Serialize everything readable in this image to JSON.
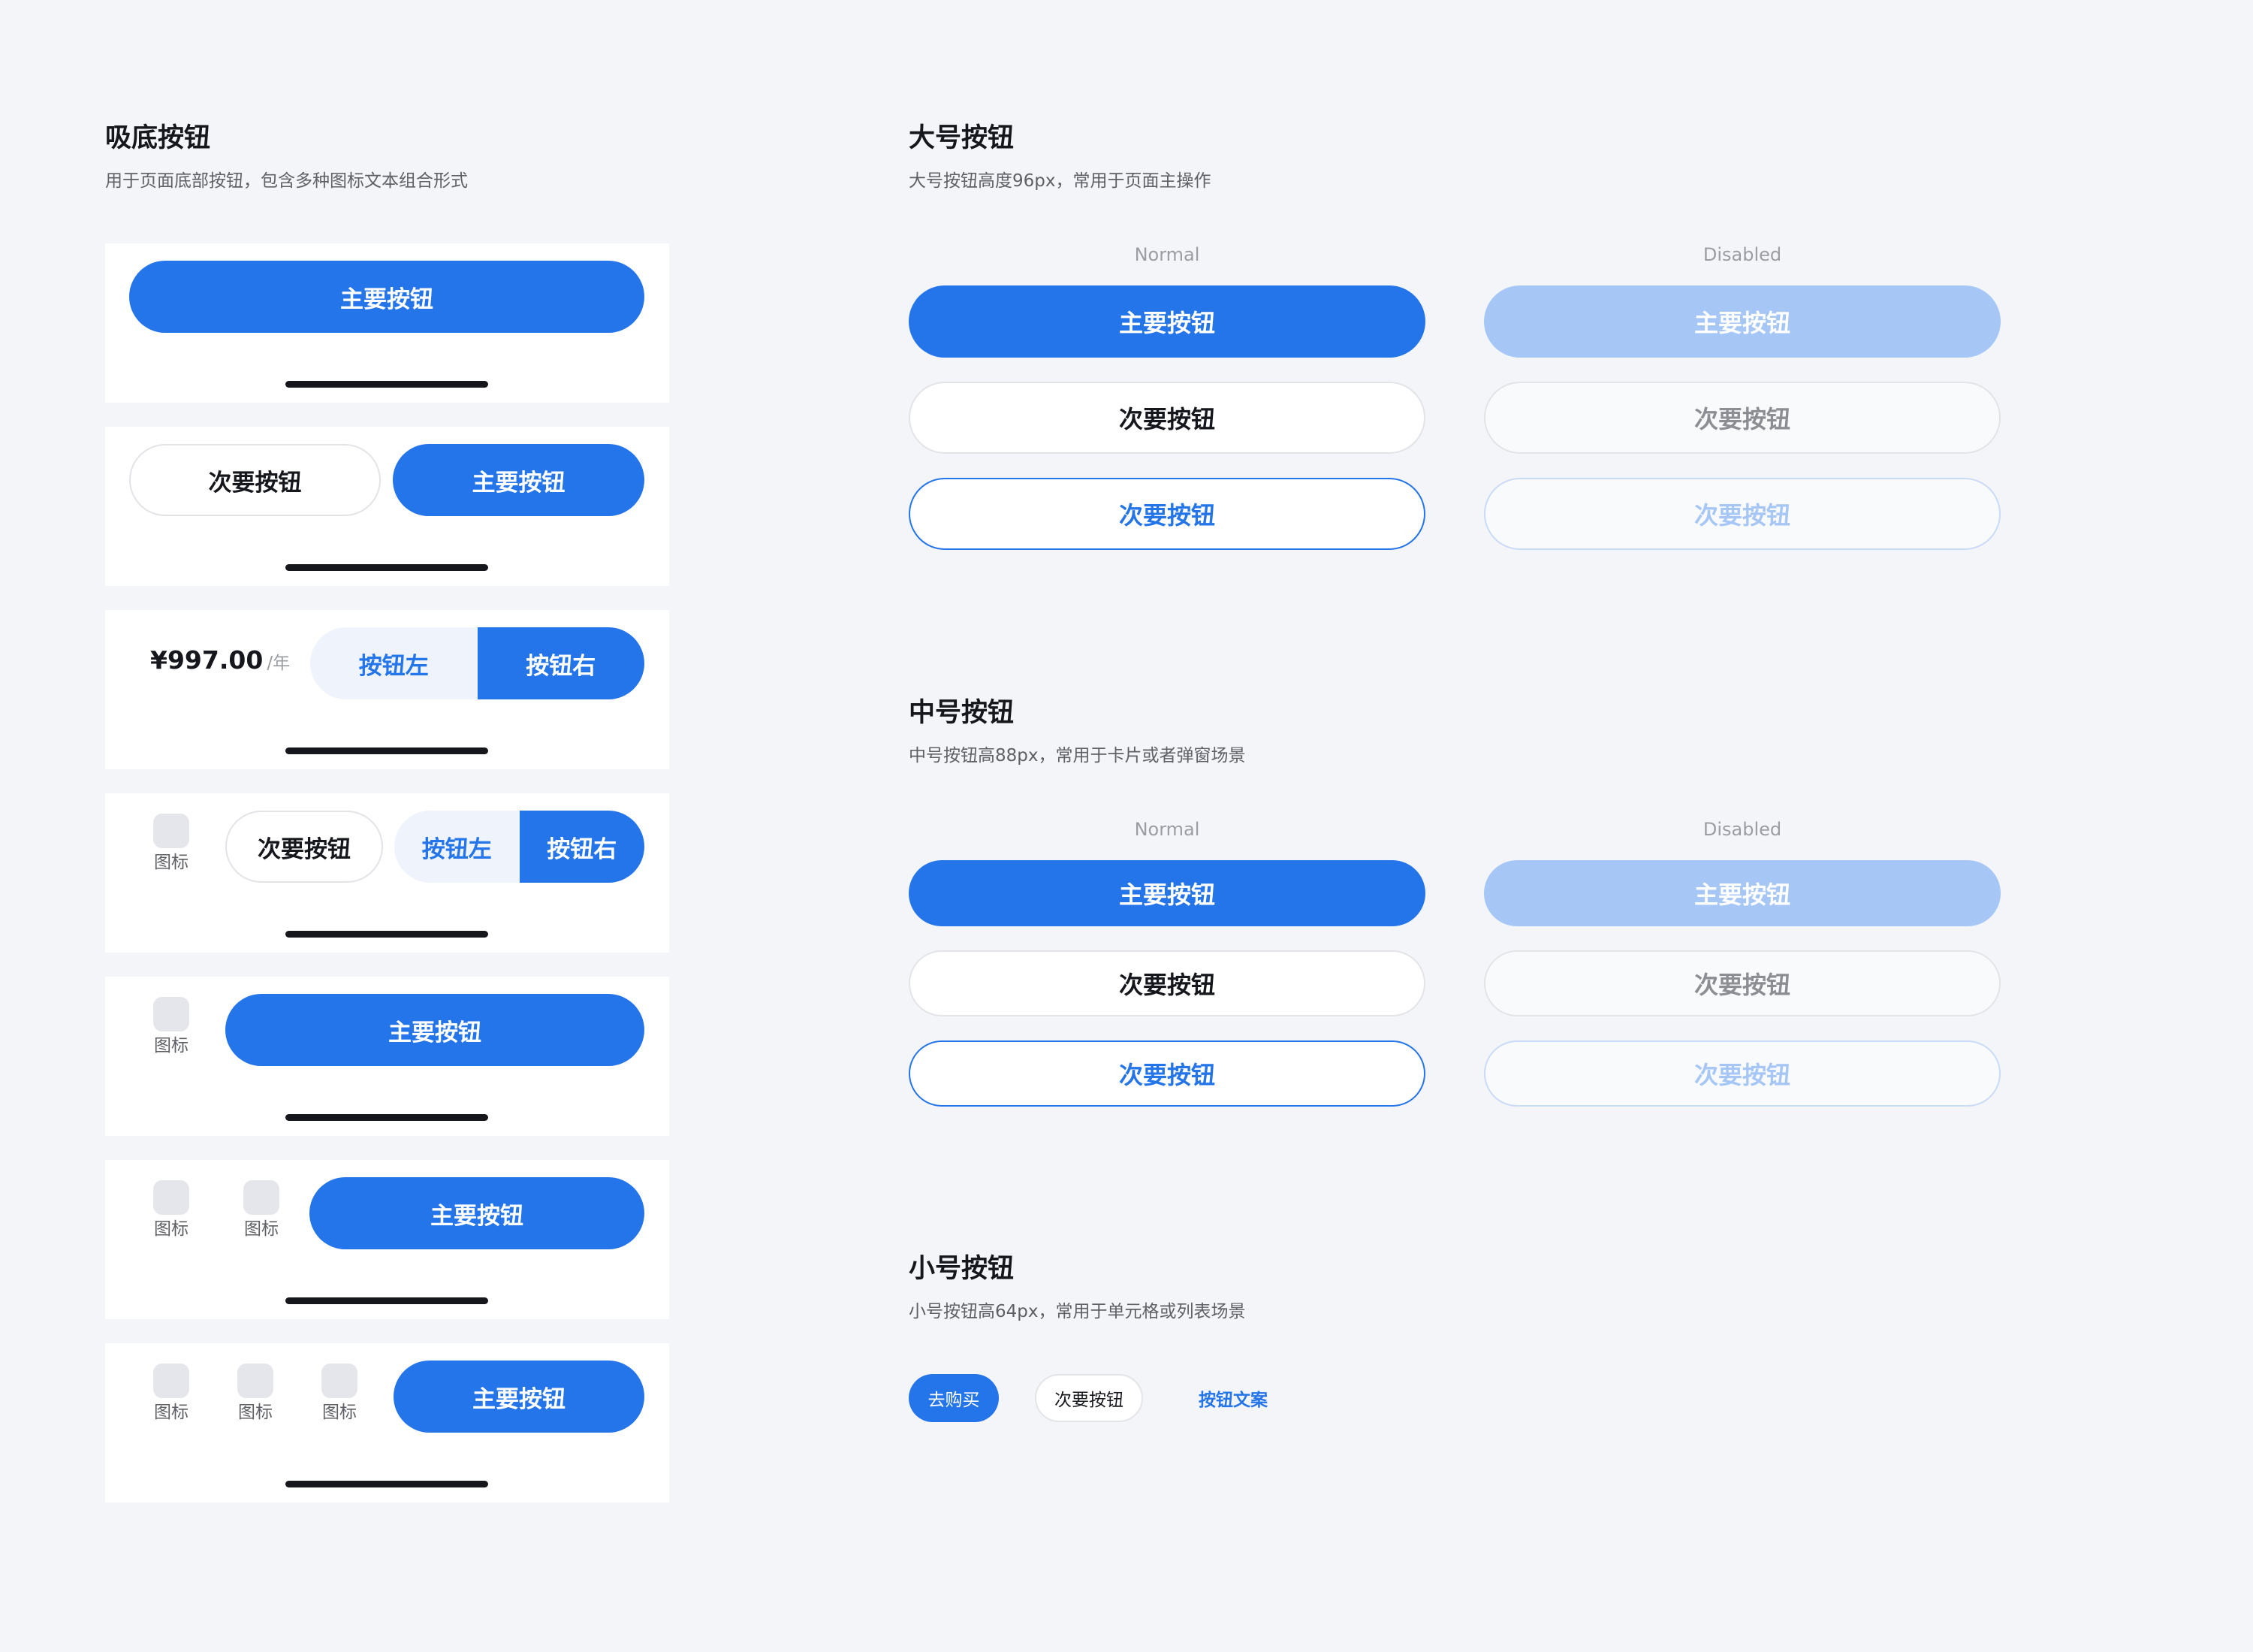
{
  "colors": {
    "background": "#F4F5F9",
    "primary": "#2474EA",
    "primary_disabled": "#A6C6F6",
    "text": "#15171C",
    "secondary_text": "#5E6066"
  },
  "sticky": {
    "title": "吸底按钮",
    "desc": "用于页面底部按钮，包含多种图标文本组合形式",
    "primary_label": "主要按钮",
    "secondary_label": "次要按钮",
    "price": "¥997.00",
    "price_unit": "/年",
    "seg_left": "按钮左",
    "seg_right": "按钮右",
    "icon_label": "图标"
  },
  "large": {
    "title": "大号按钮",
    "desc": "大号按钮高度96px，常用于页面主操作",
    "normal_label": "Normal",
    "disabled_label": "Disabled",
    "primary_label": "主要按钮",
    "secondary_label": "次要按钮",
    "ghost_label": "次要按钮"
  },
  "medium": {
    "title": "中号按钮",
    "desc": "中号按钮高88px，常用于卡片或者弹窗场景",
    "normal_label": "Normal",
    "disabled_label": "Disabled",
    "primary_label": "主要按钮",
    "secondary_label": "次要按钮",
    "ghost_label": "次要按钮"
  },
  "small": {
    "title": "小号按钮",
    "desc": "小号按钮高64px，常用于单元格或列表场景",
    "buy_label": "去购买",
    "secondary_label": "次要按钮",
    "text_label": "按钮文案"
  }
}
